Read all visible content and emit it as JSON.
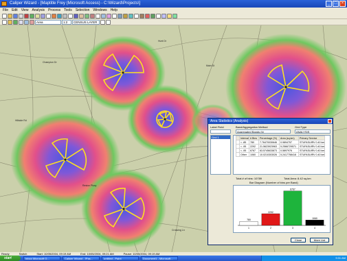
{
  "window": {
    "title": "Caliper Wizard - [Maptitle Frey (Microsoft Access) - C:\\Wizard\\Projects\\]",
    "minimize": "_",
    "maximize": "□",
    "close": "×"
  },
  "menu": [
    "File",
    "Edit",
    "View",
    "Analysis",
    "Process",
    "Tools",
    "Selection",
    "Windows",
    "Help"
  ],
  "toolbar": {
    "layer_combo": "Area",
    "scale_combo": "1:2",
    "style_combo": "CENSUS LAYER"
  },
  "map": {
    "streets": [
      "Champion Dr",
      "Hunt Dr",
      "Hillside Rd",
      "Main St",
      "Reston Pkwy",
      "Crossing Ln",
      "Oak Rd"
    ]
  },
  "dialog": {
    "title": "Area Statistics (Analysis)",
    "label_field_label": "Label Field",
    "label_field_value": "",
    "method_label": "Band/Aggregation Method",
    "method_value": "Aggregated Bands (k)",
    "grid_label": "Grid Type",
    "grid_value": "ANALYSIS",
    "list_items": [
      "Grid 1"
    ],
    "table": {
      "headers": [
        "",
        "Interval",
        "# Bins",
        "Percentage (%)",
        "Area (sq.km)",
        "Primary Service"
      ],
      "rows": [
        [
          "",
          "< -85",
          "780",
          "7.76470030646",
          "0.9894757",
          "STUFASUIRV 0.40 km"
        ],
        [
          "",
          "< -95",
          "2292",
          "21.5623923963",
          "5.2566729571",
          "STUFASUIRV 0.40 km"
        ],
        [
          "",
          "< -95",
          "6767",
          "63.5745633873",
          "0.5897976",
          "STUFASUIRV 0.40 km"
        ],
        [
          "",
          "Other",
          "1060",
          "10.0210303026",
          "5.2417758418",
          "STUFASUIRV 0.40 km"
        ]
      ]
    },
    "total_bins": "Total # of bins: 10789",
    "total_area": "Total Area: 8.42 sq.km",
    "chart_title": "Bar Diagram (Number of bins per Band)",
    "buttons": {
      "close": "Close",
      "more": "More List"
    }
  },
  "chart_data": {
    "type": "bar",
    "categories": [
      "1",
      "2",
      "3",
      "4"
    ],
    "values": [
      780,
      2292,
      6767,
      1060
    ],
    "colors": [
      "#ffffff",
      "#e01818",
      "#1eb43c",
      "#000000"
    ],
    "title": "Bar Diagram (Number of bins per Band)",
    "ylim": [
      0,
      7000
    ]
  },
  "status": {
    "ready": "Ready",
    "switch": "Switch",
    "start": "Start: 10/05/2004, 09:19 AM",
    "end": "End: 10/05/2004, 09:21 AM",
    "pause": "Pause: 10/05/2004, 09:19 AM"
  },
  "taskbar": {
    "start": "start",
    "tasks": [
      "Inbox Microsoft O...",
      "Caliper Wizard - [Pas...",
      "untitled - Paint",
      "Document1 - Microsoft..."
    ],
    "clock": "9:31 AM"
  }
}
